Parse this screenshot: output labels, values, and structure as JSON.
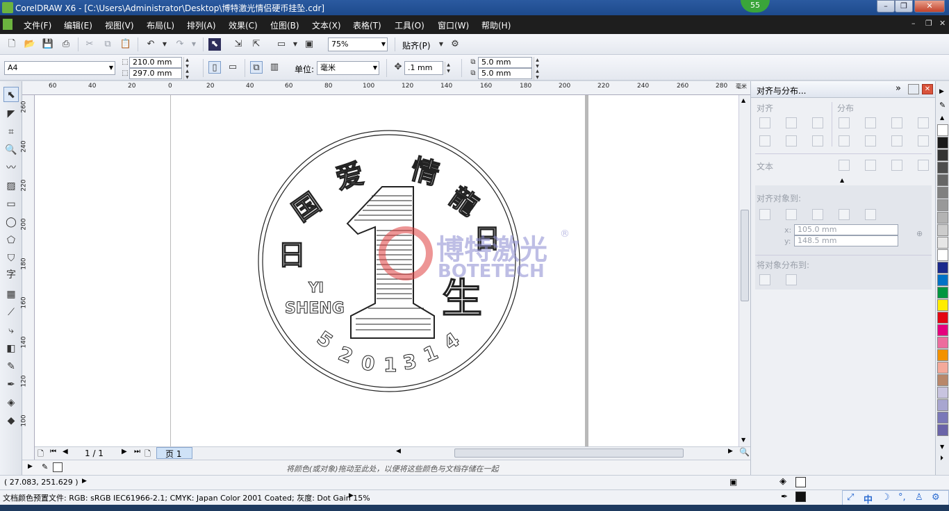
{
  "window": {
    "title": "CorelDRAW X6 - [C:\\Users\\Administrator\\Desktop\\博特激光情侣硬币挂坠.cdr]",
    "badge": "55",
    "minimize": "–",
    "restore": "❐",
    "close": "✕"
  },
  "menu": {
    "items": [
      "文件(F)",
      "编辑(E)",
      "视图(V)",
      "布局(L)",
      "排列(A)",
      "效果(C)",
      "位图(B)",
      "文本(X)",
      "表格(T)",
      "工具(O)",
      "窗口(W)",
      "帮助(H)"
    ]
  },
  "toolbar1": {
    "zoom": "75%",
    "snap": "贴齐(P)"
  },
  "toolbar2": {
    "page_size": "A4",
    "width": "210.0 mm",
    "height": "297.0 mm",
    "units_label": "单位:",
    "units": "毫米",
    "nudge": ".1 mm",
    "dup_x": "5.0 mm",
    "dup_y": "5.0 mm"
  },
  "rulers": {
    "h_ticks": [
      "60",
      "40",
      "20",
      "0",
      "20",
      "40",
      "60",
      "80",
      "100",
      "120",
      "140",
      "160",
      "180",
      "200",
      "220",
      "240",
      "260",
      "280"
    ],
    "h_unit": "毫米",
    "v_ticks": [
      "260",
      "240",
      "220",
      "200",
      "180",
      "160",
      "140",
      "120",
      "100"
    ]
  },
  "coin": {
    "left_chars": [
      "国",
      "爱",
      "情"
    ],
    "right_chars": [
      "龍",
      "日"
    ],
    "left_side": "日",
    "right_side": "生",
    "yi": "YI",
    "sheng": "SHENG",
    "numeral": "1",
    "bottom_digits": [
      "5",
      "2",
      "0",
      "1",
      "3",
      "1",
      "4"
    ]
  },
  "watermark": {
    "cn": "博特激光",
    "en": "BOTETECH",
    "reg": "®"
  },
  "pagebar": {
    "page_count": "1 / 1",
    "page_tab": "页 1"
  },
  "colorhint": "将颜色(或对象)拖动至此处，以便将这些颜色与文档存储在一起",
  "docker": {
    "title": "对齐与分布...",
    "align": "对齐",
    "distribute": "分布",
    "text": "文本",
    "align_to": "对齐对象到:",
    "x_label": "x:",
    "x_value": "105.0 mm",
    "y_label": "y:",
    "y_value": "148.5 mm",
    "distribute_to": "将对象分布到:"
  },
  "palette": [
    "#1a1a1a",
    "#333333",
    "#4d4d4d",
    "#666666",
    "#808080",
    "#999999",
    "#b3b3b3",
    "#cccccc",
    "#e6e6e6",
    "#ffffff",
    "#1b2a8c",
    "#0072c6",
    "#009640",
    "#ffed00",
    "#e30613",
    "#e5007e",
    "#ed6d9e",
    "#f39200",
    "#f4a99a",
    "#b8876a",
    "#c8c4e0",
    "#a8a6d0",
    "#7a78b8",
    "#6a64a8"
  ],
  "status": {
    "coords": "( 27.083, 251.629 )",
    "profile": "文档颜色预置文件: RGB: sRGB IEC61966-2.1; CMYK: Japan Color 2001 Coated; 灰度: Dot Gain 15%"
  },
  "tray": {
    "ime": "中"
  }
}
